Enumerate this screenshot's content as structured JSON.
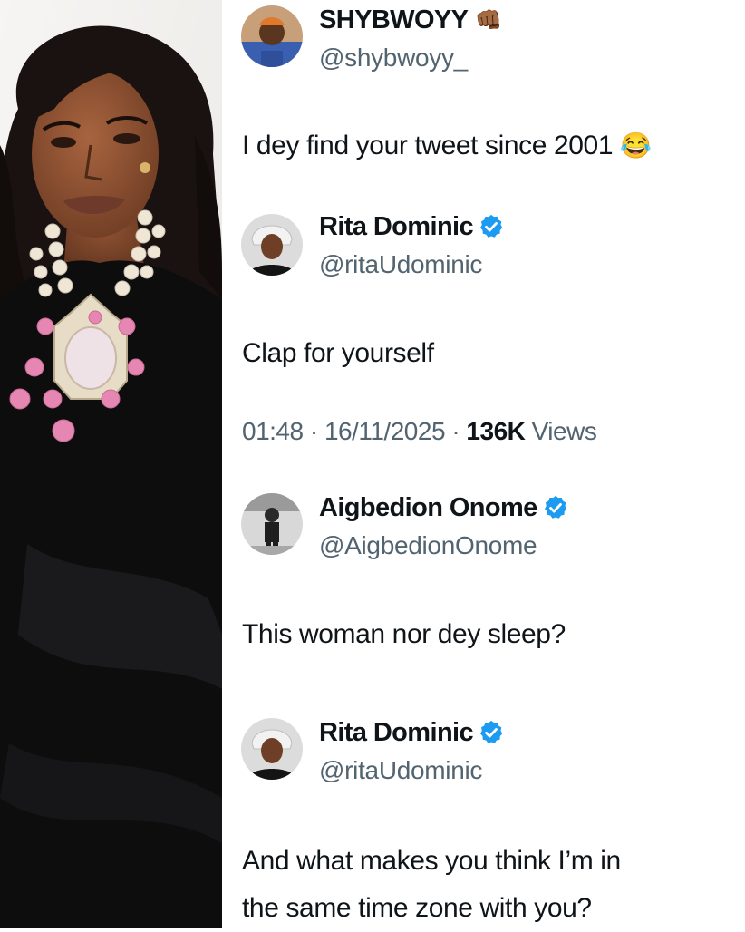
{
  "colors": {
    "verified_blue": "#1d9bf0",
    "handle_gray": "#536471",
    "text_dark": "#0f1419"
  },
  "photo": {
    "icon": "woman-portrait-photo"
  },
  "tweets": [
    {
      "name": "SHYBWOYY",
      "name_emoji": "👊🏾",
      "verified": false,
      "handle": "@shybwoyy_",
      "body": "I dey find your tweet since 2001",
      "body_emoji": "😂"
    },
    {
      "name": "Rita Dominic",
      "verified": true,
      "handle": "@ritaUdominic",
      "body": "Clap for yourself",
      "time": "01:48",
      "date": "16/11/2025",
      "views_count": "136K",
      "views_label": "Views",
      "sep": "·"
    },
    {
      "name": "Aigbedion Onome",
      "verified": true,
      "handle": "@AigbedionOnome",
      "body": "This woman nor dey sleep?"
    },
    {
      "name": "Rita Dominic",
      "verified": true,
      "handle": "@ritaUdominic",
      "body_line1": "And what makes you think I’m in",
      "body_line2": "the same time zone with you?"
    }
  ]
}
